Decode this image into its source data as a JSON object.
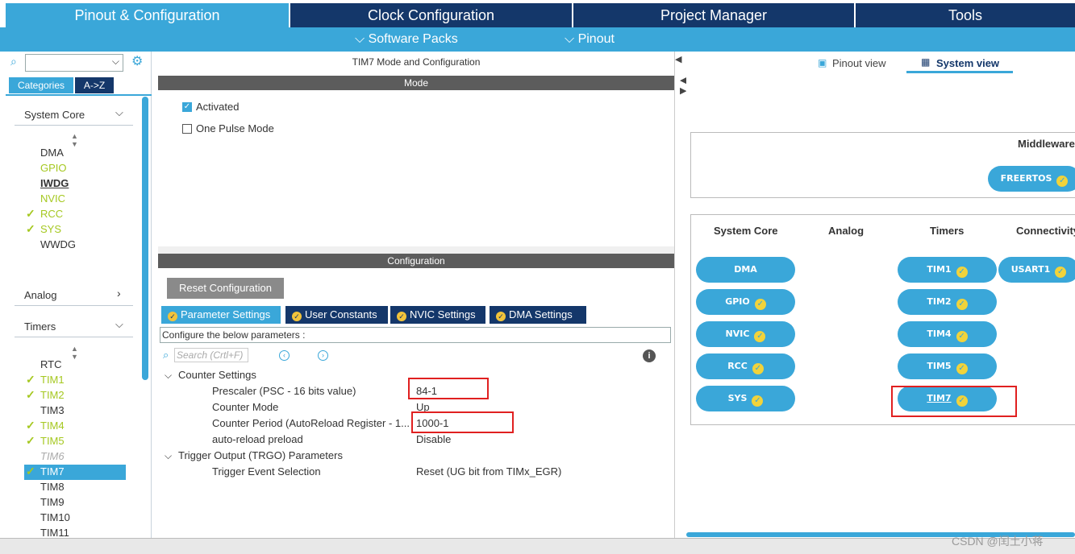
{
  "top_tabs": [
    "Pinout & Configuration",
    "Clock Configuration",
    "Project Manager",
    "Tools"
  ],
  "sub_menu": [
    "Software Packs",
    "Pinout"
  ],
  "left": {
    "categories_tab": "Categories",
    "az_tab": "A->Z",
    "system_core": {
      "title": "System Core",
      "items": [
        "DMA",
        "GPIO",
        "IWDG",
        "NVIC",
        "RCC",
        "SYS",
        "WWDG"
      ]
    },
    "analog": {
      "title": "Analog"
    },
    "timers": {
      "title": "Timers",
      "items": [
        "RTC",
        "TIM1",
        "TIM2",
        "TIM3",
        "TIM4",
        "TIM5",
        "TIM6",
        "TIM7",
        "TIM8",
        "TIM9",
        "TIM10",
        "TIM11"
      ]
    }
  },
  "middle": {
    "title": "TIM7 Mode and Configuration",
    "mode_bar": "Mode",
    "activated": "Activated",
    "one_pulse": "One Pulse Mode",
    "config_bar": "Configuration",
    "reset_button": "Reset Configuration",
    "tabs": [
      "Parameter Settings",
      "User Constants",
      "NVIC Settings",
      "DMA Settings"
    ],
    "configure_text": "Configure the below parameters :",
    "search_placeholder": "Search (Crtl+F)",
    "params": {
      "counter_settings": "Counter Settings",
      "prescaler_label": "Prescaler (PSC - 16 bits value)",
      "prescaler_value": "84-1",
      "mode_label": "Counter Mode",
      "mode_value": "Up",
      "period_label": "Counter Period (AutoReload Register - 1...",
      "period_value": "1000-1",
      "preload_label": "auto-reload preload",
      "preload_value": "Disable",
      "trgo": "Trigger Output (TRGO) Parameters",
      "trigger_label": "Trigger Event Selection",
      "trigger_value": "Reset (UG bit from TIMx_EGR)"
    }
  },
  "right": {
    "pinout_view": "Pinout view",
    "system_view": "System view",
    "middleware": "Middleware",
    "freertos": "FREERTOS",
    "columns": [
      "System Core",
      "Analog",
      "Timers",
      "Connectivity"
    ],
    "system_core_pills": [
      "DMA",
      "GPIO",
      "NVIC",
      "RCC",
      "SYS"
    ],
    "timer_pills": [
      "TIM1",
      "TIM2",
      "TIM4",
      "TIM5",
      "TIM7"
    ],
    "conn_pills": [
      "USART1"
    ]
  },
  "watermark": "CSDN @闰土小蒋",
  "colors": {
    "accent": "#3aa7d9",
    "navy": "#14376a",
    "check": "#a5c820"
  }
}
